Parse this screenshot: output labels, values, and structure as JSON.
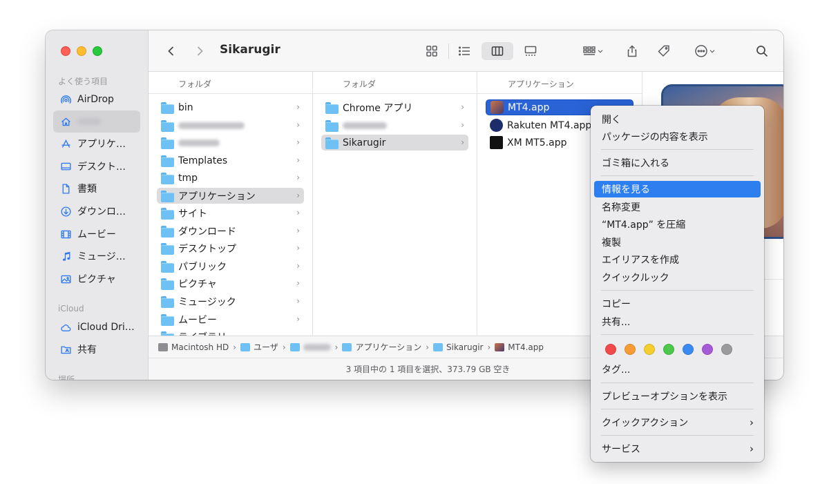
{
  "window": {
    "title": "Sikarugir"
  },
  "sidebar": {
    "favorites_heading": "よく使う項目",
    "icloud_heading": "iCloud",
    "locations_heading": "場所",
    "items": [
      {
        "label": "AirDrop",
        "icon": "airdrop-icon"
      },
      {
        "label": "",
        "icon": "home-icon"
      },
      {
        "label": "アプリケ…",
        "icon": "applications-icon"
      },
      {
        "label": "デスクト…",
        "icon": "desktop-icon"
      },
      {
        "label": "書類",
        "icon": "document-icon"
      },
      {
        "label": "ダウンロ…",
        "icon": "download-icon"
      },
      {
        "label": "ムービー",
        "icon": "film-icon"
      },
      {
        "label": "ミュージ…",
        "icon": "music-icon"
      },
      {
        "label": "ピクチャ",
        "icon": "photo-icon"
      }
    ],
    "icloud_items": [
      {
        "label": "iCloud Dri…",
        "icon": "cloud-icon"
      },
      {
        "label": "共有",
        "icon": "shared-folder-icon"
      }
    ]
  },
  "columns": [
    {
      "header": "フォルダ",
      "rows": [
        "bin",
        "",
        "",
        "Templates",
        "tmp",
        "アプリケーション",
        "サイト",
        "ダウンロード",
        "デスクトップ",
        "パブリック",
        "ピクチャ",
        "ミュージック",
        "ムービー",
        "ライブラリ"
      ]
    },
    {
      "header": "フォルダ",
      "rows": [
        "Chrome アプリ",
        "",
        "Sikarugir"
      ]
    },
    {
      "header": "アプリケーション",
      "rows": [
        "MT4.app",
        "Rakuten MT4.app",
        "XM MT5.app"
      ]
    }
  ],
  "pathbar": [
    "Macintosh HD",
    "ユーザ",
    "",
    "アプリケーション",
    "Sikarugir",
    "MT4.app"
  ],
  "status": "3 項目中の 1 項目を選択、373.79 GB 空き",
  "context_menu": {
    "groups": [
      [
        "開く",
        "パッケージの内容を表示"
      ],
      [
        "ゴミ箱に入れる"
      ],
      [
        "情報を見る",
        "名称変更",
        "“MT4.app” を圧縮",
        "複製",
        "エイリアスを作成",
        "クイックルック"
      ],
      [
        "コピー",
        "共有..."
      ],
      [
        "タグ..."
      ],
      [
        "プレビューオプションを表示"
      ],
      [
        "クイックアクション"
      ],
      [
        "サービス"
      ]
    ],
    "tag_colors": [
      "#f14a4a",
      "#f79b32",
      "#f5cd2e",
      "#4cc74a",
      "#3a8af2",
      "#a55ad8",
      "#9b9b9e"
    ]
  },
  "colors": {
    "accent": "#2d7ff0",
    "selection_blue": "#2a63d6"
  }
}
